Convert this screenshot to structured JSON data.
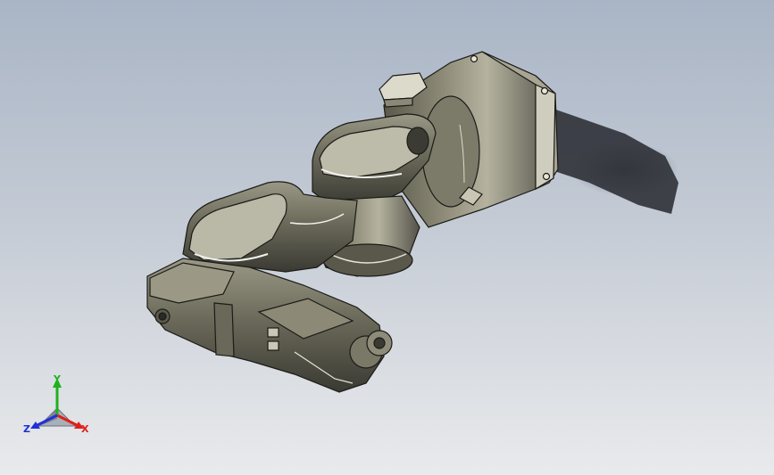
{
  "viewport": {
    "background_top": "#a9b5c6",
    "background_bottom": "#e9eaec"
  },
  "model": {
    "body_color": "#6e6c5c",
    "edge_color": "#1b1b18",
    "highlight_color": "#f2f2ee",
    "shadow_color": "#3c3e44"
  },
  "triad": {
    "x_label": "X",
    "y_label": "Y",
    "z_label": "Z",
    "x_color": "#e0201a",
    "y_color": "#1fb21f",
    "z_color": "#2030d8"
  }
}
